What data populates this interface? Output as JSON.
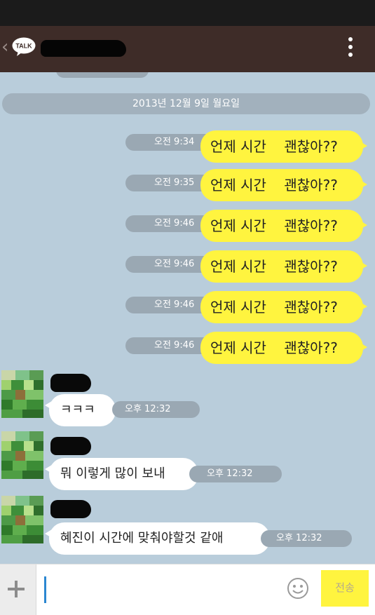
{
  "header": {
    "back_glyph": "‹",
    "logo_text": "TALK"
  },
  "chat": {
    "date_divider": "2013년 12월 9일 월요일",
    "outgoing": [
      {
        "text": "언제 시간    괜찮아??",
        "time": "오전 9:34"
      },
      {
        "text": "언제 시간    괜찮아??",
        "time": "오전 9:35"
      },
      {
        "text": "언제 시간    괜찮아??",
        "time": "오전 9:46"
      },
      {
        "text": "언제 시간    괜찮아??",
        "time": "오전 9:46"
      },
      {
        "text": "언제 시간    괜찮아??",
        "time": "오전 9:46"
      },
      {
        "text": "언제 시간    괜찮아??",
        "time": "오전 9:46"
      }
    ],
    "incoming": [
      {
        "text": "ㅋㅋㅋ",
        "time": "오후 12:32"
      },
      {
        "text": "뭐 이렇게 많이 보내",
        "time": "오후 12:32"
      },
      {
        "text": "혜진이 시간에 맞춰야할것 같애",
        "time": "오후 12:32"
      }
    ]
  },
  "input_bar": {
    "value": "",
    "send_label": "전송"
  },
  "colors": {
    "background": "#b9cddb",
    "header": "#3e2c28",
    "outgoing_bubble": "#fff43f",
    "incoming_bubble": "#ffffff",
    "caret": "#2b87d1"
  }
}
